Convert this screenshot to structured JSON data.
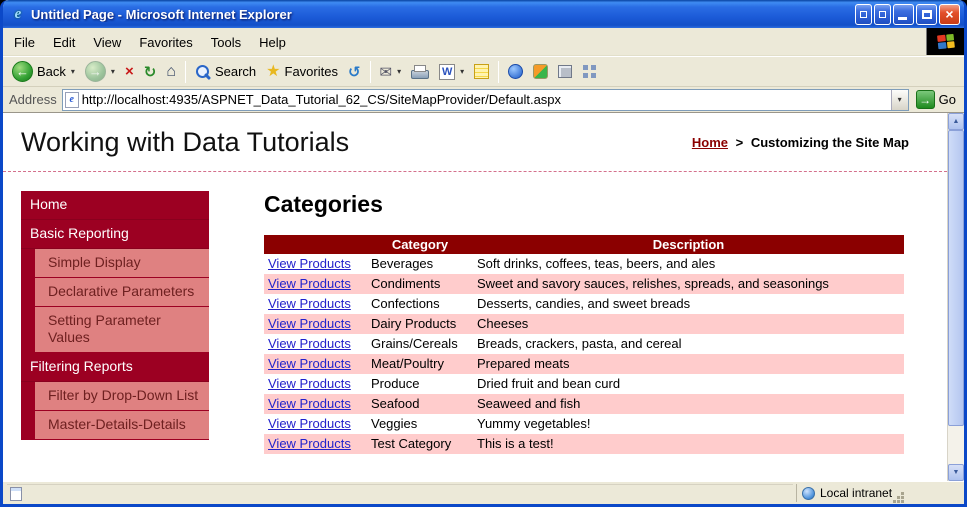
{
  "window": {
    "title": "Untitled Page - Microsoft Internet Explorer"
  },
  "menu": {
    "items": [
      "File",
      "Edit",
      "View",
      "Favorites",
      "Tools",
      "Help"
    ]
  },
  "toolbar": {
    "back_label": "Back",
    "search_label": "Search",
    "favorites_label": "Favorites"
  },
  "address_bar": {
    "label": "Address",
    "url": "http://localhost:4935/ASPNET_Data_Tutorial_62_CS/SiteMapProvider/Default.aspx",
    "go_label": "Go"
  },
  "page": {
    "header_title": "Working with Data Tutorials",
    "breadcrumb": {
      "home_label": "Home",
      "separator": ">",
      "current": "Customizing the Site Map"
    },
    "sidebar": {
      "items": [
        {
          "label": "Home",
          "level": 0
        },
        {
          "label": "Basic Reporting",
          "level": 0
        },
        {
          "label": "Simple Display",
          "level": 1
        },
        {
          "label": "Declarative Parameters",
          "level": 1
        },
        {
          "label": "Setting Parameter Values",
          "level": 1
        },
        {
          "label": "Filtering Reports",
          "level": 0
        },
        {
          "label": "Filter by Drop-Down List",
          "level": 1
        },
        {
          "label": "Master-Details-Details",
          "level": 1
        }
      ]
    },
    "main": {
      "title": "Categories",
      "table": {
        "headers": [
          "",
          "Category",
          "Description"
        ],
        "link_label": "View Products",
        "rows": [
          {
            "category": "Beverages",
            "description": "Soft drinks, coffees, teas, beers, and ales"
          },
          {
            "category": "Condiments",
            "description": "Sweet and savory sauces, relishes, spreads, and seasonings"
          },
          {
            "category": "Confections",
            "description": "Desserts, candies, and sweet breads"
          },
          {
            "category": "Dairy Products",
            "description": "Cheeses"
          },
          {
            "category": "Grains/Cereals",
            "description": "Breads, crackers, pasta, and cereal"
          },
          {
            "category": "Meat/Poultry",
            "description": "Prepared meats"
          },
          {
            "category": "Produce",
            "description": "Dried fruit and bean curd"
          },
          {
            "category": "Seafood",
            "description": "Seaweed and fish"
          },
          {
            "category": "Veggies",
            "description": "Yummy vegetables!"
          },
          {
            "category": "Test Category",
            "description": "This is a test!"
          }
        ]
      }
    }
  },
  "status_bar": {
    "zone_label": "Local intranet"
  },
  "icons": {
    "ie_logo": "e",
    "close": "×",
    "back_arrow": "←",
    "forward_arrow": "→",
    "stop": "×",
    "refresh": "↻",
    "home": "⌂",
    "favorites_star": "★",
    "history": "↺",
    "mail": "✉",
    "word": "W",
    "dropdown": "▾",
    "go_arrow": "→",
    "scroll_up": "▲",
    "scroll_down": "▼"
  },
  "colors": {
    "titlebar_blue": "#1c5bd8",
    "window_frame": "#0b48c8",
    "chrome_gray": "#ece9d8",
    "table_header_maroon": "#8b0000",
    "sidebar_parent_red": "#9c0022",
    "sidebar_child_salmon": "#df8181",
    "row_pink": "#ffcccc",
    "link_blue": "#2222cc",
    "breadcrumb_maroon": "#8b0000",
    "go_green": "#1e8a1e",
    "back_green": "#35a235"
  }
}
